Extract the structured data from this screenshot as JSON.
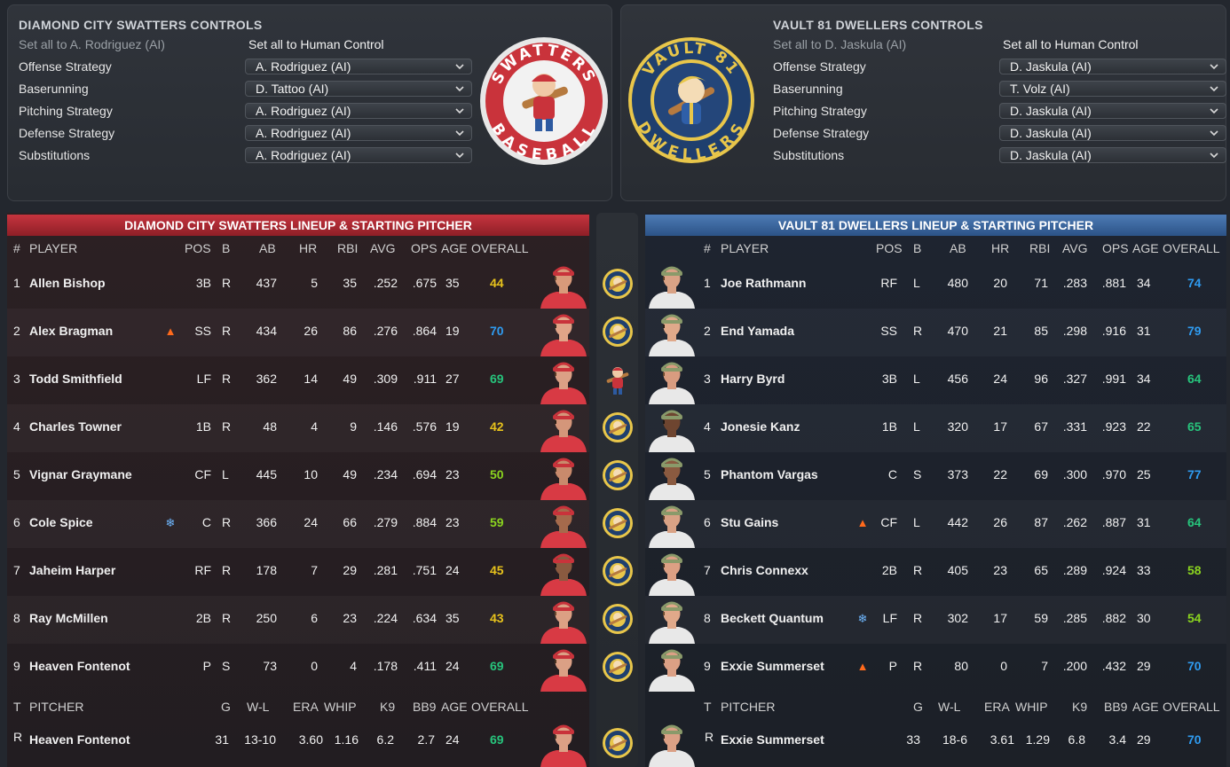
{
  "home_controls": {
    "title": "DIAMOND CITY SWATTERS CONTROLS",
    "set_all_ai": "Set all to A. Rodriguez (AI)",
    "set_all_human": "Set all to Human Control",
    "rows": [
      {
        "label": "Offense Strategy",
        "value": "A. Rodriguez (AI)"
      },
      {
        "label": "Baserunning",
        "value": "D. Tattoo (AI)"
      },
      {
        "label": "Pitching Strategy",
        "value": "A. Rodriguez (AI)"
      },
      {
        "label": "Defense Strategy",
        "value": "A. Rodriguez (AI)"
      },
      {
        "label": "Substitutions",
        "value": "A. Rodriguez (AI)"
      }
    ],
    "logo_top": "SWATTERS",
    "logo_bottom": "BASEBALL"
  },
  "away_controls": {
    "title": "VAULT 81 DWELLERS CONTROLS",
    "set_all_ai": "Set all to D. Jaskula (AI)",
    "set_all_human": "Set all to Human Control",
    "rows": [
      {
        "label": "Offense Strategy",
        "value": "D. Jaskula (AI)"
      },
      {
        "label": "Baserunning",
        "value": "T. Volz (AI)"
      },
      {
        "label": "Pitching Strategy",
        "value": "D. Jaskula (AI)"
      },
      {
        "label": "Defense Strategy",
        "value": "D. Jaskula (AI)"
      },
      {
        "label": "Substitutions",
        "value": "D. Jaskula (AI)"
      }
    ],
    "logo_top": "VAULT 81",
    "logo_bottom": "DWELLERS"
  },
  "colors": {
    "overall_yellow": "#e7c21c",
    "overall_green": "#27c47c",
    "overall_lime": "#8ad31f",
    "overall_blue": "#2f9bf0",
    "home_accent": "#c6343e",
    "away_accent": "#4d7bb5"
  },
  "home_lineup": {
    "header": "DIAMOND CITY SWATTERS LINEUP & STARTING PITCHER",
    "columns": [
      "#",
      "PLAYER",
      "POS",
      "B",
      "AB",
      "HR",
      "RBI",
      "AVG",
      "OPS",
      "AGE",
      "OVERALL"
    ],
    "players": [
      {
        "num": "1",
        "name": "Allen Bishop",
        "trait": "",
        "pos": "3B",
        "b": "R",
        "ab": "437",
        "hr": "5",
        "rbi": "35",
        "avg": ".252",
        "ops": ".675",
        "age": "35",
        "overall": "44",
        "ovr_color": "#e7c21c",
        "skin": "#d99a7a",
        "hair": "#6a4a2e"
      },
      {
        "num": "2",
        "name": "Alex Bragman",
        "trait": "fire-icon",
        "pos": "SS",
        "b": "R",
        "ab": "434",
        "hr": "26",
        "rbi": "86",
        "avg": ".276",
        "ops": ".864",
        "age": "19",
        "overall": "70",
        "ovr_color": "#2f9bf0",
        "skin": "#e0a488",
        "hair": "#3a2a1e"
      },
      {
        "num": "3",
        "name": "Todd Smithfield",
        "trait": "",
        "pos": "LF",
        "b": "R",
        "ab": "362",
        "hr": "14",
        "rbi": "49",
        "avg": ".309",
        "ops": ".911",
        "age": "27",
        "overall": "69",
        "ovr_color": "#27c47c",
        "skin": "#dba085",
        "hair": "#5a3c24"
      },
      {
        "num": "4",
        "name": "Charles Towner",
        "trait": "",
        "pos": "1B",
        "b": "R",
        "ab": "48",
        "hr": "4",
        "rbi": "9",
        "avg": ".146",
        "ops": ".576",
        "age": "19",
        "overall": "42",
        "ovr_color": "#e7c21c",
        "skin": "#d4967a",
        "hair": "#2b2018"
      },
      {
        "num": "5",
        "name": "Vignar Graymane",
        "trait": "",
        "pos": "CF",
        "b": "L",
        "ab": "445",
        "hr": "10",
        "rbi": "49",
        "avg": ".234",
        "ops": ".694",
        "age": "23",
        "overall": "50",
        "ovr_color": "#8ad31f",
        "skin": "#c98a6c",
        "hair": "#3a2a1e"
      },
      {
        "num": "6",
        "name": "Cole Spice",
        "trait": "ice-icon",
        "pos": "C",
        "b": "R",
        "ab": "366",
        "hr": "24",
        "rbi": "66",
        "avg": ".279",
        "ops": ".884",
        "age": "23",
        "overall": "59",
        "ovr_color": "#8ad31f",
        "skin": "#a56a4c",
        "hair": "#2b2018"
      },
      {
        "num": "7",
        "name": "Jaheim Harper",
        "trait": "",
        "pos": "RF",
        "b": "R",
        "ab": "178",
        "hr": "7",
        "rbi": "29",
        "avg": ".281",
        "ops": ".751",
        "age": "24",
        "overall": "45",
        "ovr_color": "#e7c21c",
        "skin": "#8a5a40",
        "hair": "#1e1814"
      },
      {
        "num": "8",
        "name": "Ray McMillen",
        "trait": "",
        "pos": "2B",
        "b": "R",
        "ab": "250",
        "hr": "6",
        "rbi": "23",
        "avg": ".224",
        "ops": ".634",
        "age": "35",
        "overall": "43",
        "ovr_color": "#e7c21c",
        "skin": "#dca084",
        "hair": "#6a4a2e"
      },
      {
        "num": "9",
        "name": "Heaven Fontenot",
        "trait": "",
        "pos": "P",
        "b": "S",
        "ab": "73",
        "hr": "0",
        "rbi": "4",
        "avg": ".178",
        "ops": ".411",
        "age": "24",
        "overall": "69",
        "ovr_color": "#27c47c",
        "skin": "#dba085",
        "hair": "#4a3422"
      }
    ],
    "pitcher_columns": [
      "T",
      "PITCHER",
      "G",
      "W-L",
      "ERA",
      "WHIP",
      "K9",
      "BB9",
      "AGE",
      "OVERALL"
    ],
    "pitcher": {
      "t": "R",
      "name": "Heaven Fontenot",
      "g": "31",
      "wl": "13-10",
      "era": "3.60",
      "whip": "1.16",
      "k9": "6.2",
      "bb9": "2.7",
      "age": "24",
      "overall": "69",
      "ovr_color": "#27c47c",
      "skin": "#dba085",
      "hair": "#4a3422"
    }
  },
  "away_lineup": {
    "header": "VAULT 81 DWELLERS LINEUP & STARTING PITCHER",
    "columns": [
      "#",
      "PLAYER",
      "POS",
      "B",
      "AB",
      "HR",
      "RBI",
      "AVG",
      "OPS",
      "AGE",
      "OVERALL"
    ],
    "players": [
      {
        "num": "1",
        "name": "Joe Rathmann",
        "trait": "",
        "pos": "RF",
        "b": "L",
        "ab": "480",
        "hr": "20",
        "rbi": "71",
        "avg": ".283",
        "ops": ".881",
        "age": "34",
        "overall": "74",
        "ovr_color": "#2f9bf0",
        "skin": "#d9a285",
        "hair": "#5a3c24"
      },
      {
        "num": "2",
        "name": "End Yamada",
        "trait": "",
        "pos": "SS",
        "b": "R",
        "ab": "470",
        "hr": "21",
        "rbi": "85",
        "avg": ".298",
        "ops": ".916",
        "age": "31",
        "overall": "79",
        "ovr_color": "#2f9bf0",
        "skin": "#e0a98a",
        "hair": "#2b2018"
      },
      {
        "num": "3",
        "name": "Harry Byrd",
        "trait": "",
        "pos": "3B",
        "b": "L",
        "ab": "456",
        "hr": "24",
        "rbi": "96",
        "avg": ".327",
        "ops": ".991",
        "age": "34",
        "overall": "64",
        "ovr_color": "#27c47c",
        "skin": "#d89c80",
        "hair": "#6a4a2e"
      },
      {
        "num": "4",
        "name": "Jonesie Kanz",
        "trait": "",
        "pos": "1B",
        "b": "L",
        "ab": "320",
        "hr": "17",
        "rbi": "67",
        "avg": ".331",
        "ops": ".923",
        "age": "22",
        "overall": "65",
        "ovr_color": "#27c47c",
        "skin": "#6e4530",
        "hair": "#1e1814"
      },
      {
        "num": "5",
        "name": "Phantom Vargas",
        "trait": "",
        "pos": "C",
        "b": "S",
        "ab": "373",
        "hr": "22",
        "rbi": "69",
        "avg": ".300",
        "ops": ".970",
        "age": "25",
        "overall": "77",
        "ovr_color": "#2f9bf0",
        "skin": "#8a5a40",
        "hair": "#1e1814"
      },
      {
        "num": "6",
        "name": "Stu Gains",
        "trait": "fire-icon",
        "pos": "CF",
        "b": "L",
        "ab": "442",
        "hr": "26",
        "rbi": "87",
        "avg": ".262",
        "ops": ".887",
        "age": "31",
        "overall": "64",
        "ovr_color": "#27c47c",
        "skin": "#d9a285",
        "hair": "#5a3c24"
      },
      {
        "num": "7",
        "name": "Chris Connexx",
        "trait": "",
        "pos": "2B",
        "b": "R",
        "ab": "405",
        "hr": "23",
        "rbi": "65",
        "avg": ".289",
        "ops": ".924",
        "age": "33",
        "overall": "58",
        "ovr_color": "#8ad31f",
        "skin": "#dca084",
        "hair": "#4a3422"
      },
      {
        "num": "8",
        "name": "Beckett Quantum",
        "trait": "ice-icon",
        "pos": "LF",
        "b": "R",
        "ab": "302",
        "hr": "17",
        "rbi": "59",
        "avg": ".285",
        "ops": ".882",
        "age": "30",
        "overall": "54",
        "ovr_color": "#8ad31f",
        "skin": "#e0a98a",
        "hair": "#6a4a2e"
      },
      {
        "num": "9",
        "name": "Exxie Summerset",
        "trait": "fire-icon",
        "pos": "P",
        "b": "R",
        "ab": "80",
        "hr": "0",
        "rbi": "7",
        "avg": ".200",
        "ops": ".432",
        "age": "29",
        "overall": "70",
        "ovr_color": "#2f9bf0",
        "skin": "#dba085",
        "hair": "#3a2a1e"
      }
    ],
    "pitcher_columns": [
      "T",
      "PITCHER",
      "G",
      "W-L",
      "ERA",
      "WHIP",
      "K9",
      "BB9",
      "AGE",
      "OVERALL"
    ],
    "pitcher": {
      "t": "R",
      "name": "Exxie Summerset",
      "g": "33",
      "wl": "18-6",
      "era": "3.61",
      "whip": "1.29",
      "k9": "6.8",
      "bb9": "3.4",
      "age": "29",
      "overall": "70",
      "ovr_color": "#2f9bf0",
      "skin": "#dba085",
      "hair": "#3a2a1e"
    }
  },
  "matchup_icons": [
    "vault-logo-icon",
    "vault-logo-icon",
    "swatters-mascot-icon",
    "vault-logo-icon",
    "vault-logo-icon",
    "vault-logo-icon",
    "vault-logo-icon",
    "vault-logo-icon",
    "vault-logo-icon",
    "vault-logo-icon"
  ]
}
